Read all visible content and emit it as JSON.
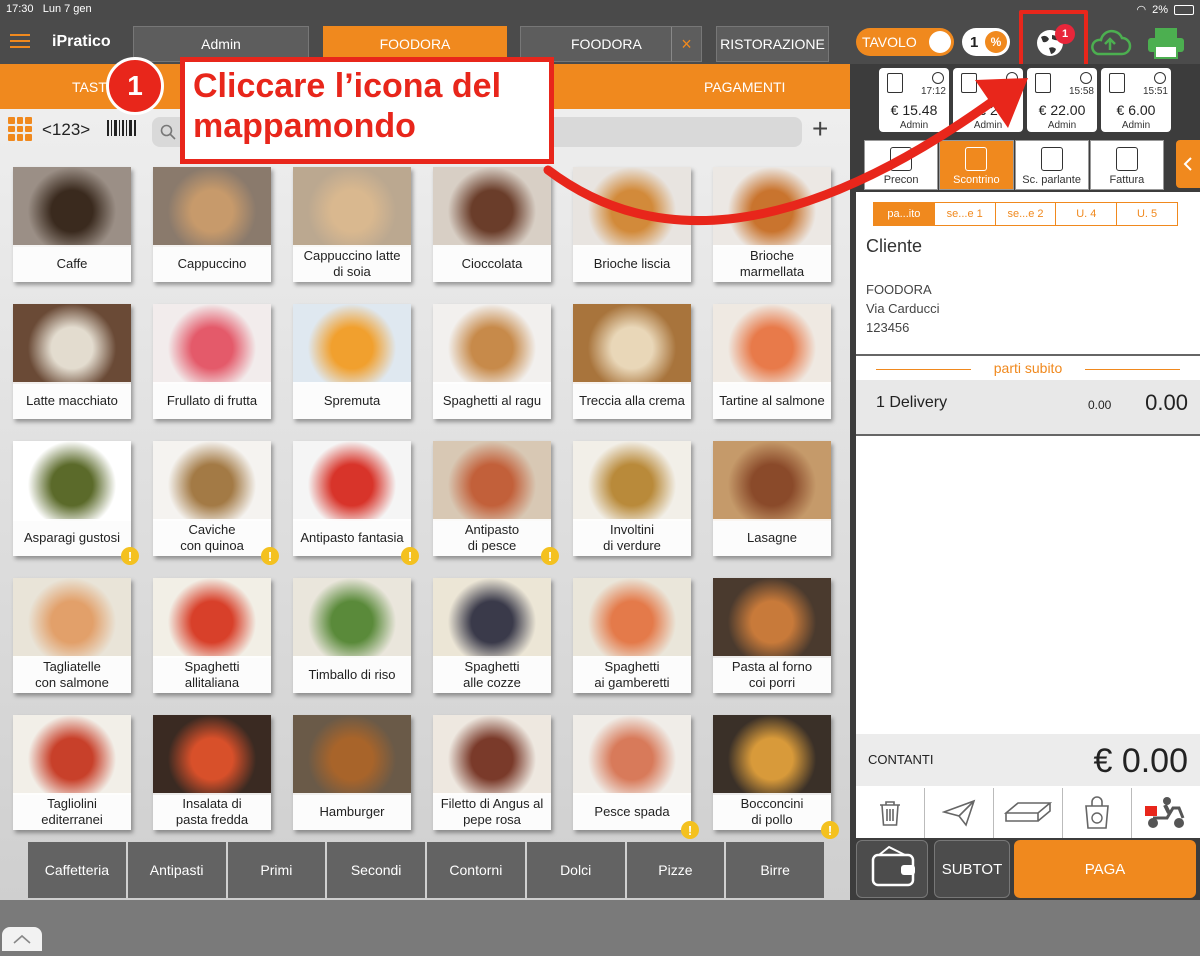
{
  "status": {
    "time": "17:30",
    "date": "Lun 7 gen",
    "battery": "2%"
  },
  "header": {
    "app_name": "iPratico",
    "user": "Admin",
    "channel": "FOODORA",
    "channel_field": "FOODORA",
    "clear": "×",
    "mode": "RISTORAZIONE",
    "tavolo": "TAVOLO",
    "count": "1",
    "pct": "%",
    "notif_count": "1"
  },
  "tabs": {
    "tasti": "TASTI",
    "pagamenti": "PAGAMENTI"
  },
  "tools": {
    "pager": "<123>",
    "plus": "+"
  },
  "products": [
    {
      "name": "Caffe",
      "warn": false,
      "c1": "#9b8f86",
      "c2": "#3a2a1e"
    },
    {
      "name": "Cappuccino",
      "warn": false,
      "c1": "#8a7a6c",
      "c2": "#c79a6b"
    },
    {
      "name": "Cappuccino latte\ndi soia",
      "warn": false,
      "c1": "#bba890",
      "c2": "#d9b88f"
    },
    {
      "name": "Cioccolata",
      "warn": false,
      "c1": "#d8cfc5",
      "c2": "#6a3d2a"
    },
    {
      "name": "Brioche liscia",
      "warn": false,
      "c1": "#e8e4e0",
      "c2": "#d28a3a"
    },
    {
      "name": "Brioche\nmarmellata",
      "warn": false,
      "c1": "#ece8e4",
      "c2": "#c9742e"
    },
    {
      "name": "Latte macchiato",
      "warn": false,
      "c1": "#6a4a36",
      "c2": "#e3dccf"
    },
    {
      "name": "Frullato di frutta",
      "warn": false,
      "c1": "#f2ecec",
      "c2": "#e45a6a"
    },
    {
      "name": "Spremuta",
      "warn": false,
      "c1": "#dfe8f0",
      "c2": "#f1a02e"
    },
    {
      "name": "Spaghetti al ragu",
      "warn": false,
      "c1": "#f2f0ee",
      "c2": "#c78a4a"
    },
    {
      "name": "Treccia alla crema",
      "warn": false,
      "c1": "#a8743c",
      "c2": "#e9d7b8"
    },
    {
      "name": "Tartine al salmone",
      "warn": false,
      "c1": "#efe9e2",
      "c2": "#e87a4a"
    },
    {
      "name": "Asparagi gustosi",
      "warn": true,
      "c1": "#ffffff",
      "c2": "#5b6a2a"
    },
    {
      "name": "Caviche\ncon quinoa",
      "warn": true,
      "c1": "#f5f3f0",
      "c2": "#a37a45"
    },
    {
      "name": "Antipasto fantasia",
      "warn": true,
      "c1": "#f5f5f5",
      "c2": "#d8342a"
    },
    {
      "name": "Antipasto\ndi pesce",
      "warn": true,
      "c1": "#d8c8b4",
      "c2": "#c2603a"
    },
    {
      "name": "Involtini\ndi verdure",
      "warn": false,
      "c1": "#f2efe8",
      "c2": "#b98a3a"
    },
    {
      "name": "Lasagne",
      "warn": false,
      "c1": "#c59a6a",
      "c2": "#8a4a2a"
    },
    {
      "name": "Tagliatelle\ncon salmone",
      "warn": false,
      "c1": "#e9e4d8",
      "c2": "#e2a06a"
    },
    {
      "name": "Spaghetti\nallitaliana",
      "warn": false,
      "c1": "#f2efe6",
      "c2": "#d8402a"
    },
    {
      "name": "Timballo di riso",
      "warn": false,
      "c1": "#eae6dc",
      "c2": "#5a8a3a"
    },
    {
      "name": "Spaghetti\nalle cozze",
      "warn": false,
      "c1": "#ece6d6",
      "c2": "#3a3a4a"
    },
    {
      "name": "Spaghetti\nai gamberetti",
      "warn": false,
      "c1": "#eae6da",
      "c2": "#e47a4a"
    },
    {
      "name": "Pasta al forno\ncoi porri",
      "warn": false,
      "c1": "#4a3a2e",
      "c2": "#c87a3a"
    },
    {
      "name": "Tagliolini\nediterranei",
      "warn": false,
      "c1": "#f2efe8",
      "c2": "#c8402a"
    },
    {
      "name": "Insalata di\npasta fredda",
      "warn": false,
      "c1": "#3a2a22",
      "c2": "#d8502a"
    },
    {
      "name": "Hamburger",
      "warn": false,
      "c1": "#6a5a48",
      "c2": "#a8642a"
    },
    {
      "name": "Filetto di Angus al\npepe rosa",
      "warn": false,
      "c1": "#eee8e0",
      "c2": "#7a3a2a"
    },
    {
      "name": "Pesce spada",
      "warn": true,
      "c1": "#f0ede8",
      "c2": "#d87a5a"
    },
    {
      "name": "Bocconcini\ndi pollo",
      "warn": true,
      "c1": "#3a3028",
      "c2": "#d89a3a"
    }
  ],
  "categories": [
    "Caffetteria",
    "Antipasti",
    "Primi",
    "Secondi",
    "Contorni",
    "Dolci",
    "Pizze",
    "Birre"
  ],
  "recent": [
    {
      "time": "17:12",
      "amount": "€ 15.48",
      "user": "Admin"
    },
    {
      "time": "",
      "amount": "€ 2",
      "user": "Admin"
    },
    {
      "time": "15:58",
      "amount": "€ 22.00",
      "user": "Admin"
    },
    {
      "time": "15:51",
      "amount": "€ 6.00",
      "user": "Admin"
    }
  ],
  "doctabs": [
    "Precon",
    "Scontrino",
    "Sc. parlante",
    "Fattura"
  ],
  "subtabs": [
    "pa...ito",
    "se...e 1",
    "se...e 2",
    "U. 4",
    "U. 5"
  ],
  "receipt": {
    "cliente": "Cliente",
    "name": "FOODORA",
    "street": "Via  Carducci",
    "code": "123456",
    "parti": "parti subito",
    "line_qty": "1 Delivery",
    "line_unit": "0.00",
    "line_total": "0.00",
    "tot_label": "CONTANTI",
    "tot_value": "€ 0.00"
  },
  "bottom": {
    "subtot": "SUBTOT",
    "paga": "PAGA"
  },
  "callout": {
    "num": "1",
    "text": "Cliccare l’icona del mappamondo"
  },
  "colors": {
    "accent": "#f0891e",
    "highlight": "#e8261b"
  }
}
